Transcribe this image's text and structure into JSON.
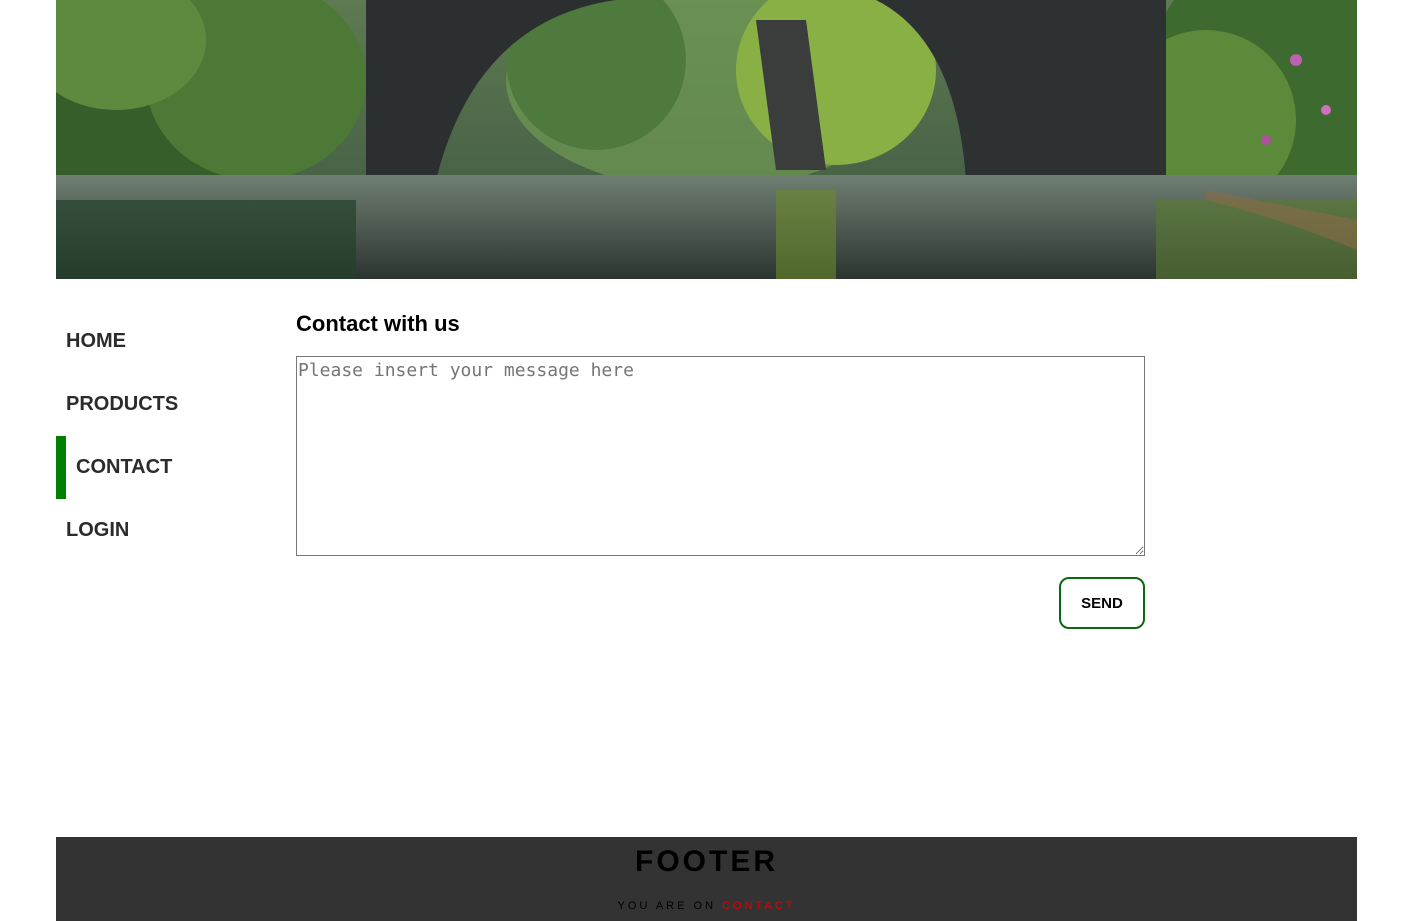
{
  "hero": {
    "image": "forest-river-stone-bridge"
  },
  "nav": {
    "items": [
      {
        "label": "HOME",
        "active": false
      },
      {
        "label": "PRODUCTS",
        "active": false
      },
      {
        "label": "CONTACT",
        "active": true
      },
      {
        "label": "LOGIN",
        "active": false
      }
    ]
  },
  "main": {
    "title": "Contact with us",
    "message_placeholder": "Please insert your message here",
    "message_value": "",
    "send_label": "SEND"
  },
  "footer": {
    "title": "FOOTER",
    "location_prefix": "YOU ARE ON",
    "location_current": "CONTACT"
  },
  "colors": {
    "accent": "#008000",
    "send_border": "#0b6a0b",
    "footer_bg": "#333333",
    "current_page": "#e00000"
  }
}
